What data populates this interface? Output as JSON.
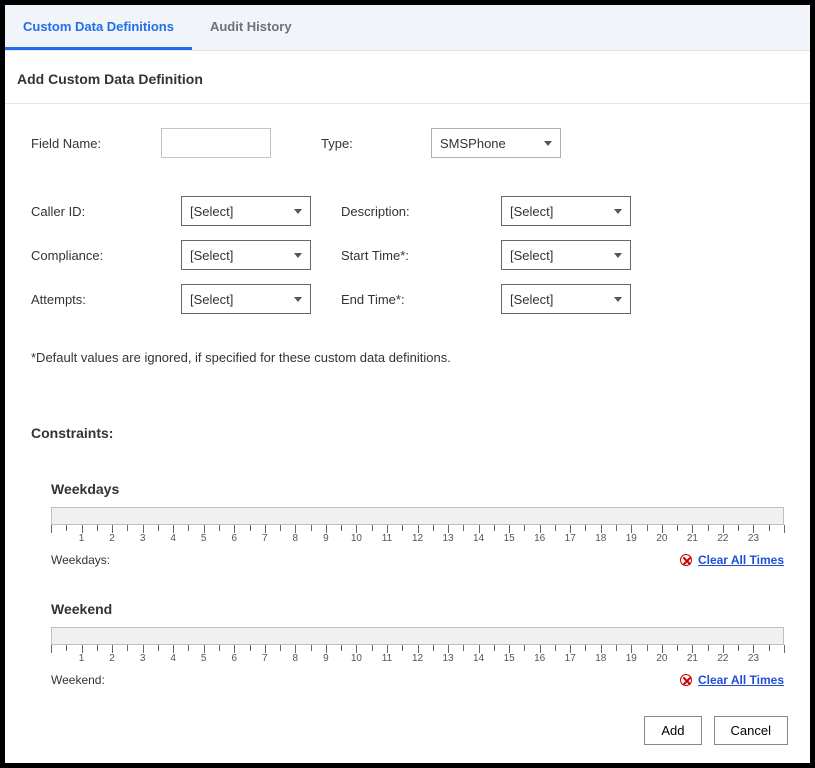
{
  "tabs": {
    "definitions": "Custom Data Definitions",
    "audit": "Audit History"
  },
  "section_title": "Add Custom Data Definition",
  "labels": {
    "field_name": "Field Name:",
    "type": "Type:",
    "caller_id": "Caller ID:",
    "description": "Description:",
    "compliance": "Compliance:",
    "start_time": "Start Time*:",
    "attempts": "Attempts:",
    "end_time": "End Time*:"
  },
  "values": {
    "field_name": "",
    "type": "SMSPhone",
    "caller_id": "[Select]",
    "description": "[Select]",
    "compliance": "[Select]",
    "start_time": "[Select]",
    "attempts": "[Select]",
    "end_time": "[Select]"
  },
  "note": "*Default values are ignored, if specified for these custom data definitions.",
  "constraints": {
    "title": "Constraints:",
    "hours": [
      "1",
      "2",
      "3",
      "4",
      "5",
      "6",
      "7",
      "8",
      "9",
      "10",
      "11",
      "12",
      "13",
      "14",
      "15",
      "16",
      "17",
      "18",
      "19",
      "20",
      "21",
      "22",
      "23"
    ],
    "weekdays": {
      "heading": "Weekdays",
      "footer_label": "Weekdays:",
      "clear": "Clear All Times"
    },
    "weekend": {
      "heading": "Weekend",
      "footer_label": "Weekend:",
      "clear": "Clear All Times"
    }
  },
  "buttons": {
    "add": "Add",
    "cancel": "Cancel"
  }
}
